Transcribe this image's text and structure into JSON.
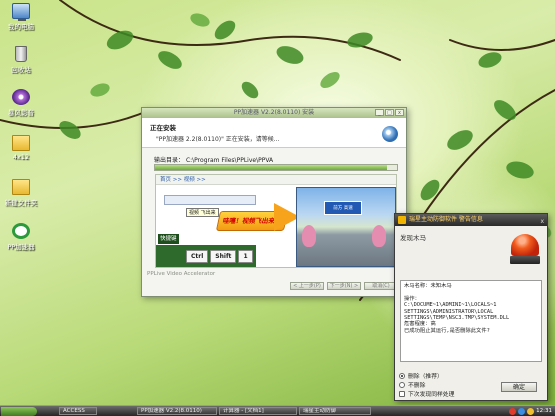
{
  "desktop": {
    "icons": [
      {
        "label": "我的电脑",
        "icon": "computer-icon"
      },
      {
        "label": "回收站",
        "icon": "recycle-bin-icon"
      },
      {
        "label": "暴风影音",
        "icon": "media-player-icon"
      },
      {
        "label": "4x12",
        "icon": "folder-icon"
      },
      {
        "label": "新建文件夹",
        "icon": "folder-icon"
      },
      {
        "label": "PP加速器",
        "icon": "pp-accelerator-icon"
      }
    ]
  },
  "installer": {
    "title": "PP加速器 V2.2(8.0110) 安装",
    "heading": "正在安装",
    "subheading": "\"PP加速器 2.2(8.0110)\" 正在安装，请等候...",
    "output_label": "输出目录：",
    "output_path": "C:\\Program Files\\PPLive\\PPVA",
    "progress_pct": 96,
    "banner": {
      "address": "首页 >> 视频 >>",
      "tooltip": "视频 飞出来",
      "splash": "哇噻！视频飞出来了",
      "road_sign": "前方 高速",
      "key_tag": "快捷键",
      "keys": [
        "Ctrl",
        "Shift",
        "1"
      ]
    },
    "brand": "PPLive Video Accelerator",
    "buttons": [
      "< 上一步(P)",
      "下一步(N) >",
      "取消(C)"
    ],
    "window_buttons": [
      "_",
      "□",
      "x"
    ]
  },
  "alert": {
    "title": "瑞星主动防御软件  警告信息",
    "close": "x",
    "heading": "发现木马",
    "details": [
      "木马名称：未知木马",
      "",
      "操作：",
      "C:\\DOCUME~1\\ADMINI~1\\LOCALS~1",
      "SETTINGS\\ADMINISTRATOR\\LOCAL",
      "SETTINGS\\TEMP\\NSC3.TMP\\SYSTEM.DLL",
      "危害程度：高",
      "已成功阻止其运行,是否删除此文件?"
    ],
    "options": [
      {
        "label": "删除（推荐）",
        "selected": true
      },
      {
        "label": "不删除",
        "selected": false
      },
      {
        "label": "下次发现同样处理",
        "selected": false
      }
    ],
    "ok_button": "确定"
  },
  "taskbar": {
    "items": [
      "ACCESS",
      "PP加速器 V2.2(8.0110)",
      "计算器 - [文档1]",
      "瑞星主动防御"
    ],
    "clock": "12:31"
  },
  "colors": {
    "taskbar": "#2f2f2f",
    "alert_title": "#2a2a2a",
    "progress": "#6fa83b",
    "splash": "#f39a12"
  }
}
